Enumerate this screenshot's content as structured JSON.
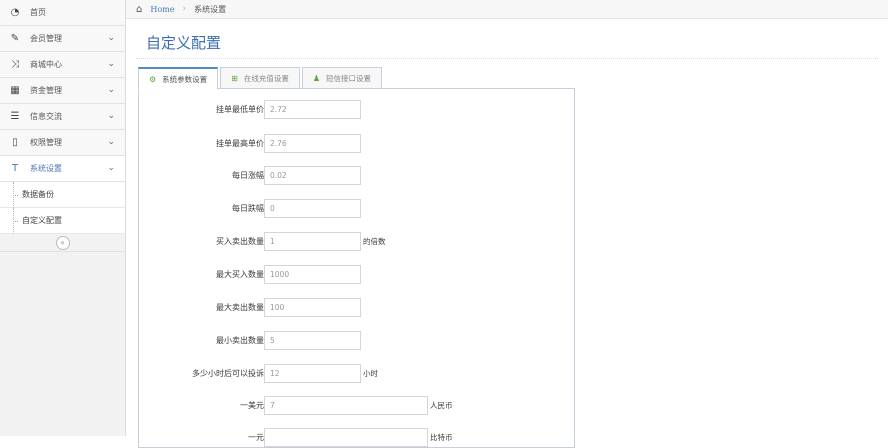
{
  "sidebar": {
    "items": [
      {
        "label": "首页",
        "icon": "tachometer-icon",
        "glyph": "◔"
      },
      {
        "label": "会员管理",
        "icon": "edit-icon",
        "glyph": "✎"
      },
      {
        "label": "商城中心",
        "icon": "shuffle-icon",
        "glyph": "⤨"
      },
      {
        "label": "资金管理",
        "icon": "calendar-icon",
        "glyph": "▦"
      },
      {
        "label": "信息交流",
        "icon": "list-icon",
        "glyph": "☰"
      },
      {
        "label": "权限管理",
        "icon": "file-icon",
        "glyph": "▯"
      },
      {
        "label": "系统设置",
        "icon": "text-width-icon",
        "glyph": "T"
      }
    ],
    "chevron": "⌄",
    "sub_items": [
      "数据备份",
      "自定义配置"
    ],
    "collapse_glyph": "«"
  },
  "breadcrumb": {
    "home_glyph": "⌂",
    "home": "Home",
    "separator": "›",
    "current": "系统设置"
  },
  "page_title": "自定义配置",
  "tabs": [
    {
      "label": "系统参数设置",
      "glyph": "⚙"
    },
    {
      "label": "在线充值设置",
      "glyph": "⊞"
    },
    {
      "label": "短信接口设置",
      "glyph": "♟"
    }
  ],
  "form": {
    "rows": [
      {
        "label": "挂单最低单价",
        "value": "2.72",
        "suffix": ""
      },
      {
        "label": "挂单最高单价",
        "value": "2.76",
        "suffix": ""
      },
      {
        "label": "每日涨幅",
        "value": "0.02",
        "suffix": ""
      },
      {
        "label": "每日跌幅",
        "value": "0",
        "suffix": ""
      },
      {
        "label": "买入卖出数量",
        "value": "1",
        "suffix": "的倍数"
      },
      {
        "label": "最大买入数量",
        "value": "1000",
        "suffix": ""
      },
      {
        "label": "最大卖出数量",
        "value": "100",
        "suffix": ""
      },
      {
        "label": "最小卖出数量",
        "value": "5",
        "suffix": ""
      },
      {
        "label": "多少小时后可以投诉",
        "value": "12",
        "suffix": "小时"
      },
      {
        "label": "一美元",
        "value": "7",
        "suffix": "人民币"
      },
      {
        "label": "一元",
        "value": "",
        "suffix": "比特币"
      }
    ]
  },
  "colors": {
    "accent": "#3c6db0",
    "tab_border": "#4c8fbd",
    "sidebar_bg": "#f2f2f2"
  }
}
